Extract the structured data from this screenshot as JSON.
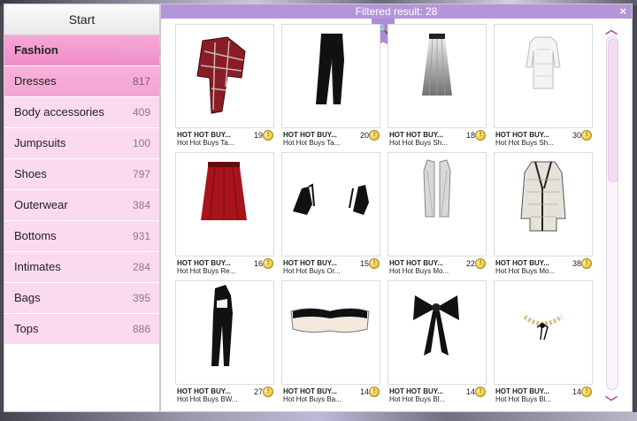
{
  "left": {
    "start_label": "Start",
    "categories": [
      {
        "label": "Fashion",
        "count": "1000+"
      },
      {
        "label": "Dresses",
        "count": "817"
      },
      {
        "label": "Body accessories",
        "count": "409"
      },
      {
        "label": "Jumpsuits",
        "count": "100"
      },
      {
        "label": "Shoes",
        "count": "797"
      },
      {
        "label": "Outerwear",
        "count": "384"
      },
      {
        "label": "Bottoms",
        "count": "931"
      },
      {
        "label": "Intimates",
        "count": "284"
      },
      {
        "label": "Bags",
        "count": "395"
      },
      {
        "label": "Tops",
        "count": "886"
      }
    ]
  },
  "header": {
    "filtered_label": "Filtered result: 28",
    "close_glyph": "×",
    "search_icon": "🔍"
  },
  "scroll": {
    "up_glyph": "︿",
    "down_glyph": "﹀"
  },
  "items": [
    {
      "brand": "HOT HOT BUY...",
      "name": "Hot Hot Buys Ta...",
      "price": "19",
      "icon": "plaid-scarf"
    },
    {
      "brand": "HOT HOT BUY...",
      "name": "Hot Hot Buys Ta...",
      "price": "20",
      "icon": "black-pants"
    },
    {
      "brand": "HOT HOT BUY...",
      "name": "Hot Hot Buys Sh...",
      "price": "18",
      "icon": "silver-skirt"
    },
    {
      "brand": "HOT HOT BUY...",
      "name": "Hot Hot Buys Sh...",
      "price": "30",
      "icon": "white-dress"
    },
    {
      "brand": "HOT HOT BUY...",
      "name": "Hot Hot Buys Re...",
      "price": "16",
      "icon": "red-skirt"
    },
    {
      "brand": "HOT HOT BUY...",
      "name": "Hot Hot Buys Or...",
      "price": "15",
      "icon": "black-heels"
    },
    {
      "brand": "HOT HOT BUY...",
      "name": "Hot Hot Buys Mo...",
      "price": "22",
      "icon": "grey-vest"
    },
    {
      "brand": "HOT HOT BUY...",
      "name": "Hot Hot Buys Mo...",
      "price": "38",
      "icon": "tweed-coat"
    },
    {
      "brand": "HOT HOT BUY...",
      "name": "Hot Hot Buys BW...",
      "price": "27",
      "icon": "black-jumpsuit"
    },
    {
      "brand": "HOT HOT BUY...",
      "name": "Hot Hot Buys Ba...",
      "price": "14",
      "icon": "bandeau-top"
    },
    {
      "brand": "HOT HOT BUY...",
      "name": "Hot Hot Buys Bl...",
      "price": "14",
      "icon": "black-bow"
    },
    {
      "brand": "HOT HOT BUY...",
      "name": "Hot Hot Buys Bl...",
      "price": "14",
      "icon": "pearl-collar"
    }
  ],
  "coin_glyph": "!",
  "colors": {
    "accent": "#b496d8",
    "active_category": "#f7a6d6",
    "category_bg": "#fbd9f0",
    "scroll_arrow": "#c040a0"
  }
}
